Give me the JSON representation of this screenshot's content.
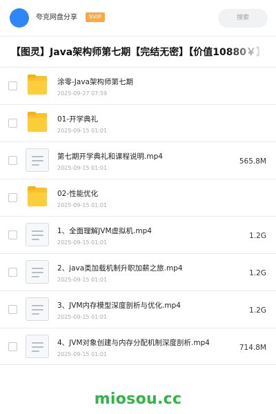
{
  "header": {
    "share_name": "夸克网盘分享",
    "badge": "SVIP",
    "search_label": "搜索"
  },
  "title": "【图灵】Java架构师第七期【完结无密】【价值10880￥】",
  "files": [
    {
      "type": "folder",
      "icon": "folder-icon",
      "name": "涂零-Java架构师第七期",
      "date": "2025-09-27 07:59",
      "size": ""
    },
    {
      "type": "folder",
      "icon": "folder-icon",
      "name": "01-开学典礼",
      "date": "2025-09-15 01:01",
      "size": ""
    },
    {
      "type": "file",
      "icon": "document-icon",
      "name": "第七期开学典礼和课程说明.mp4",
      "date": "2025-09-15 01:01",
      "size": "565.8M"
    },
    {
      "type": "folder",
      "icon": "folder-icon",
      "name": "02-性能优化",
      "date": "2025-09-15 01:01",
      "size": ""
    },
    {
      "type": "file",
      "icon": "document-icon",
      "name": "1、全面理解JVM虚拟机.mp4",
      "date": "2025-09-15 01:01",
      "size": "1.2G"
    },
    {
      "type": "file",
      "icon": "document-icon",
      "name": "2、java类加载机制升职加薪之旅.mp4",
      "date": "2025-09-15 01:01",
      "size": "1.2G"
    },
    {
      "type": "file",
      "icon": "document-icon",
      "name": "3、JVM内存模型深度剖析与优化.mp4",
      "date": "2025-09-15 01:01",
      "size": "1.2G"
    },
    {
      "type": "file",
      "icon": "document-icon",
      "name": "4、JVM对象创建与内存分配机制深度剖析.mp4",
      "date": "2025-09-15 01:01",
      "size": "714.8M"
    }
  ],
  "watermark": "miosou.cc",
  "colors": {
    "accent": "#2f86f6",
    "svip": "#f5a94a",
    "folder": "#fccf3a",
    "watermark": "#2fb544"
  }
}
